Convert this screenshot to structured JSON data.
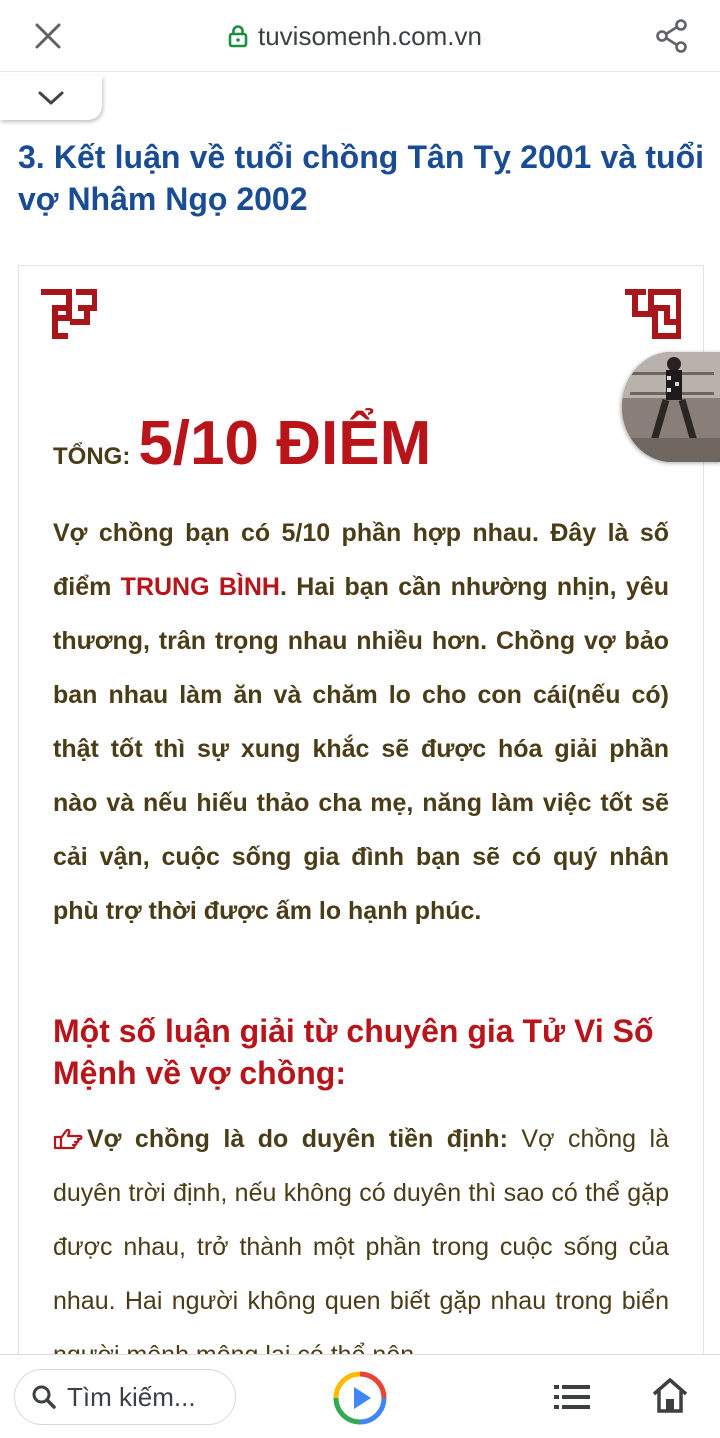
{
  "browser": {
    "url": "tuvisomenh.com.vn",
    "icons": [
      "close-icon",
      "lock-icon",
      "share-icon",
      "chevron-down-icon"
    ]
  },
  "article": {
    "heading": "3. Kết luận về tuổi chồng Tân Tỵ 2001 và tuổi vợ Nhâm Ngọ 2002",
    "score_label": "TỔNG:",
    "score_value": "5/10 ĐIỂM",
    "para1_before": "Vợ chồng bạn có 5/10 phần hợp nhau. Đây là số điểm ",
    "para1_highlight": "TRUNG BÌNH",
    "para1_after": ". Hai bạn cần nhường nhịn, yêu thương, trân trọng nhau nhiều hơn. Chồng vợ bảo ban nhau làm ăn và chăm lo cho con cái(nếu có) thật tốt thì sự xung khắc sẽ được hóa giải phần nào và nếu hiếu thảo cha mẹ, năng làm việc tốt sẽ cải vận, cuộc sống gia đình bạn sẽ có quý nhân phù trợ thời được ấm lo hạnh phúc.",
    "subheading": "Một số luận giải từ chuyên gia Tử Vi Số Mệnh về vợ chồng:",
    "point_lead": "Vợ chồng là do duyên tiền định:",
    "point_text": " Vợ chồng là duyên trời định, nếu không có duyên thì sao có thể gặp được nhau, trở thành một phần trong cuộc sống của nhau. Hai người không quen biết gặp nhau trong biển người mênh mông lại có thể nên"
  },
  "bottom_bar": {
    "search_placeholder": "Tìm kiếm...",
    "icons": [
      "search-icon",
      "play-icon",
      "menu-icon",
      "home-icon"
    ]
  },
  "colors": {
    "heading": "#1a4c96",
    "accent_red": "#b8141a",
    "body_text": "#4a3c16",
    "lock_green": "#1e8e3e"
  }
}
